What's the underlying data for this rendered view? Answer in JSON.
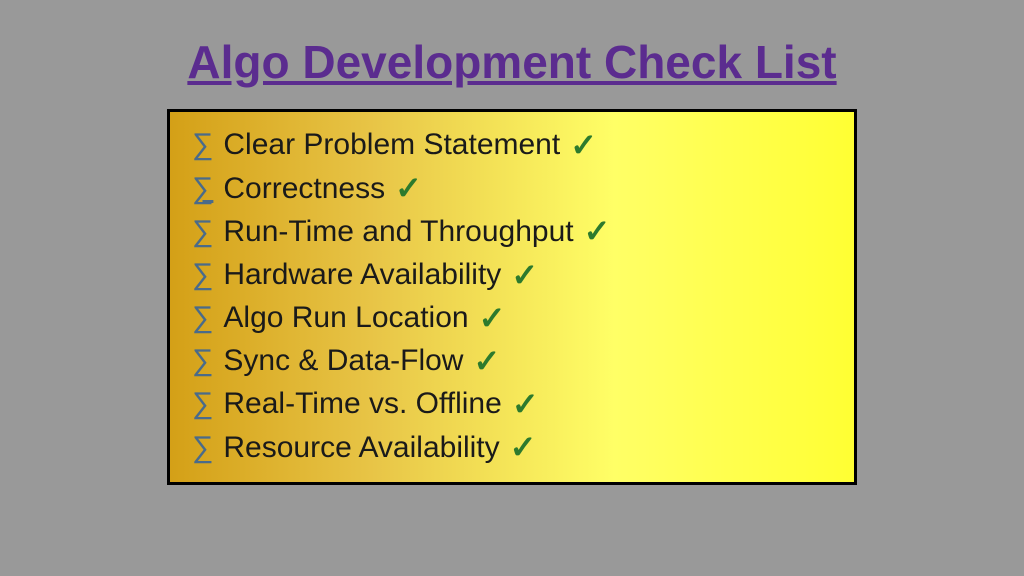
{
  "title": "Algo Development Check List",
  "items": [
    {
      "label": "Clear Problem Statement",
      "checked": true
    },
    {
      "label": "Correctness",
      "checked": true
    },
    {
      "label": "Run-Time and Throughput",
      "checked": true
    },
    {
      "label": "Hardware Availability",
      "checked": true
    },
    {
      "label": "Algo Run Location",
      "checked": true
    },
    {
      "label": "Sync & Data-Flow",
      "checked": true
    },
    {
      "label": "Real-Time vs. Offline",
      "checked": true
    },
    {
      "label": "Resource Availability",
      "checked": true
    }
  ],
  "bullet_symbol": "∑",
  "check_symbol": "✓"
}
